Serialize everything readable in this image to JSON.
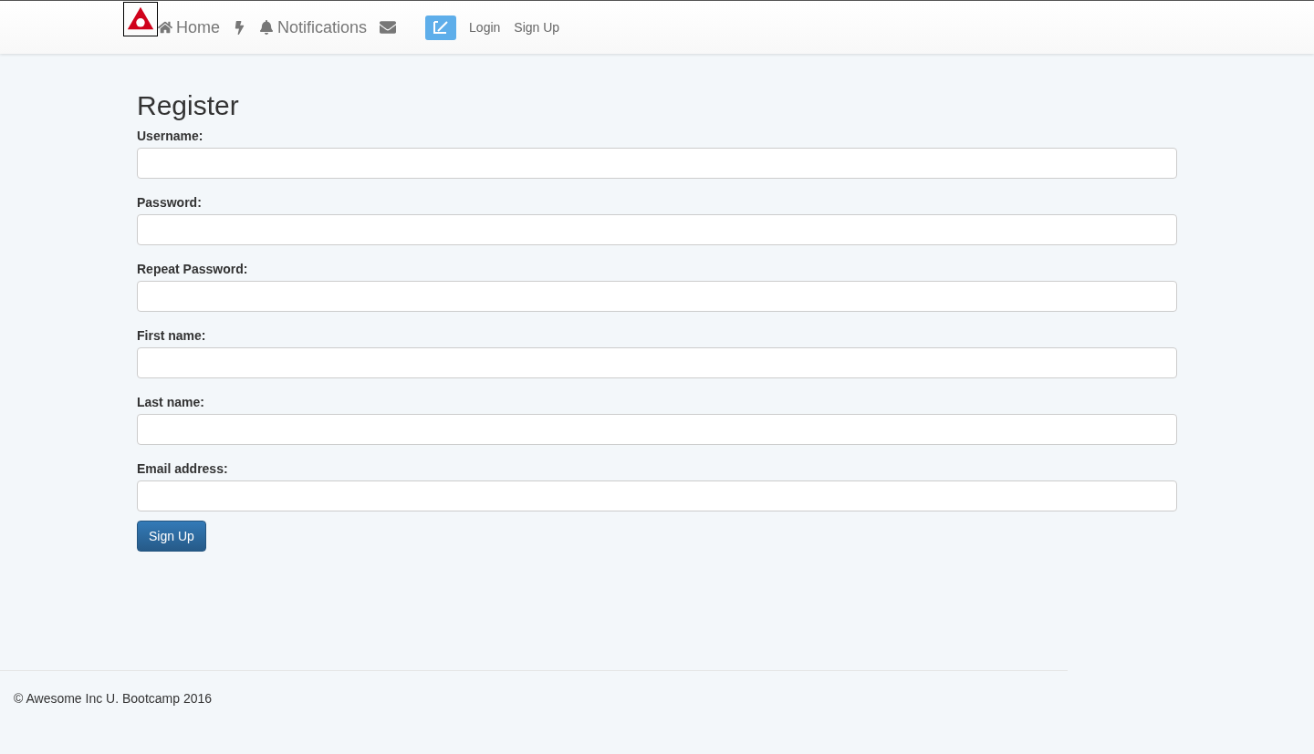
{
  "navbar": {
    "items": [
      {
        "kind": "home",
        "label": "Home"
      },
      {
        "kind": "bolt"
      },
      {
        "kind": "bell",
        "label": "Notifications"
      },
      {
        "kind": "mail"
      },
      {
        "kind": "compose"
      }
    ],
    "auth_links": [
      "Login",
      "Sign Up"
    ]
  },
  "form": {
    "title": "Register",
    "fields": [
      {
        "label": "Username:"
      },
      {
        "label": "Password:"
      },
      {
        "label": "Repeat Password:"
      },
      {
        "label": "First name:"
      },
      {
        "label": "Last name:"
      },
      {
        "label": "Email address:"
      }
    ],
    "submit": "Sign Up"
  },
  "footer": {
    "text": "© Awesome Inc U. Bootcamp 2016"
  }
}
